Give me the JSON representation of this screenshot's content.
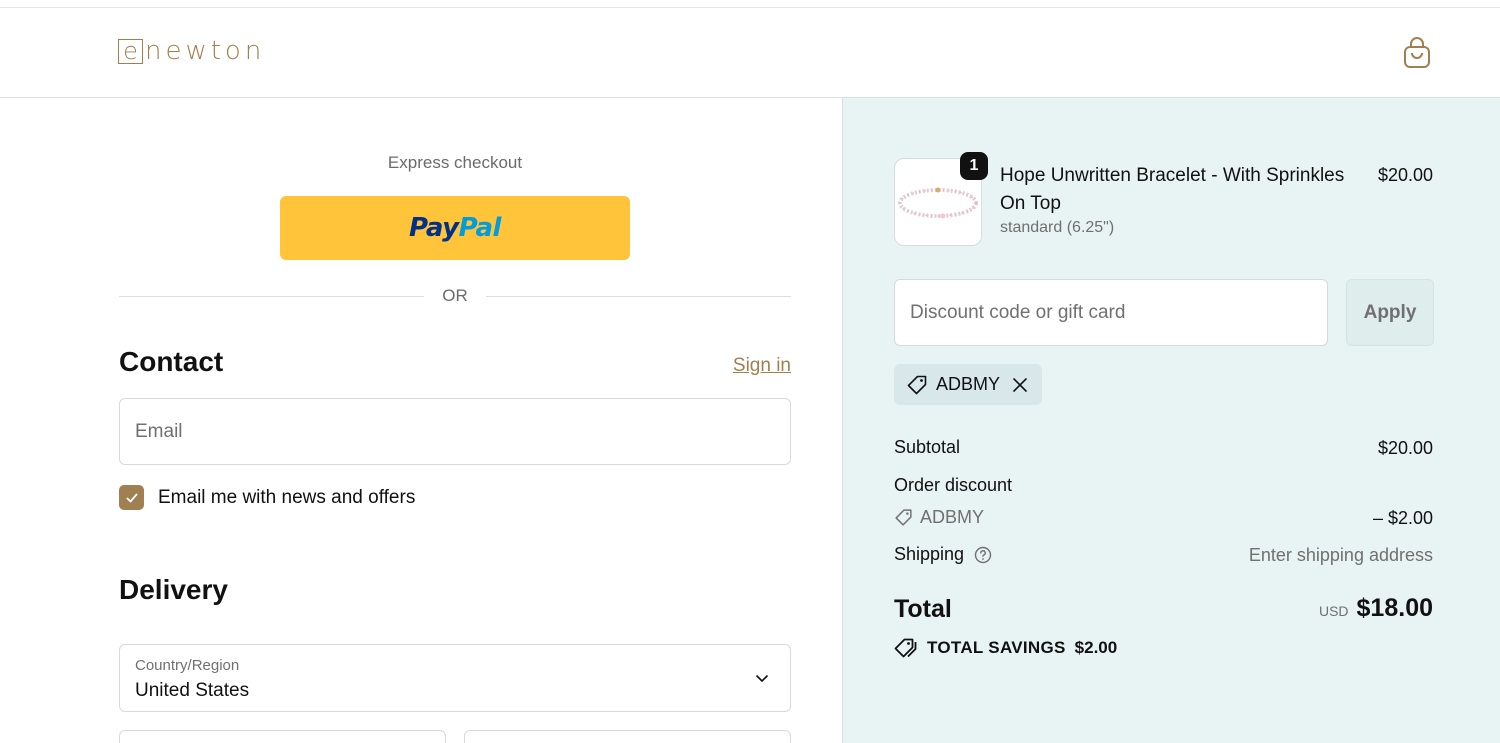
{
  "header": {
    "logo_letter": "e",
    "logo_text": "newton",
    "cart_icon": "shopping-bag-icon"
  },
  "express": {
    "title": "Express checkout",
    "paypal_pay": "Pay",
    "paypal_pal": "Pal",
    "divider": "OR"
  },
  "contact": {
    "title": "Contact",
    "sign_in": "Sign in",
    "email_placeholder": "Email",
    "newsletter_label": "Email me with news and offers",
    "newsletter_checked": true
  },
  "delivery": {
    "title": "Delivery",
    "country_label": "Country/Region",
    "country_value": "United States"
  },
  "summary": {
    "item": {
      "quantity": "1",
      "name": "Hope Unwritten Bracelet - With Sprinkles On Top",
      "variant": "standard (6.25\")",
      "price": "$20.00"
    },
    "discount_placeholder": "Discount code or gift card",
    "apply_label": "Apply",
    "applied_code": "ADBMY",
    "subtotal_label": "Subtotal",
    "subtotal_value": "$20.00",
    "order_discount_label": "Order discount",
    "order_discount_code": "ADBMY",
    "order_discount_value": "– $2.00",
    "shipping_label": "Shipping",
    "shipping_value": "Enter shipping address",
    "total_label": "Total",
    "currency": "USD",
    "total_value": "$18.00",
    "savings_label": "TOTAL SAVINGS",
    "savings_value": "$2.00"
  },
  "colors": {
    "brand": "#a08050",
    "paypal_yellow": "#ffc439",
    "summary_bg": "#e8f3f3"
  }
}
